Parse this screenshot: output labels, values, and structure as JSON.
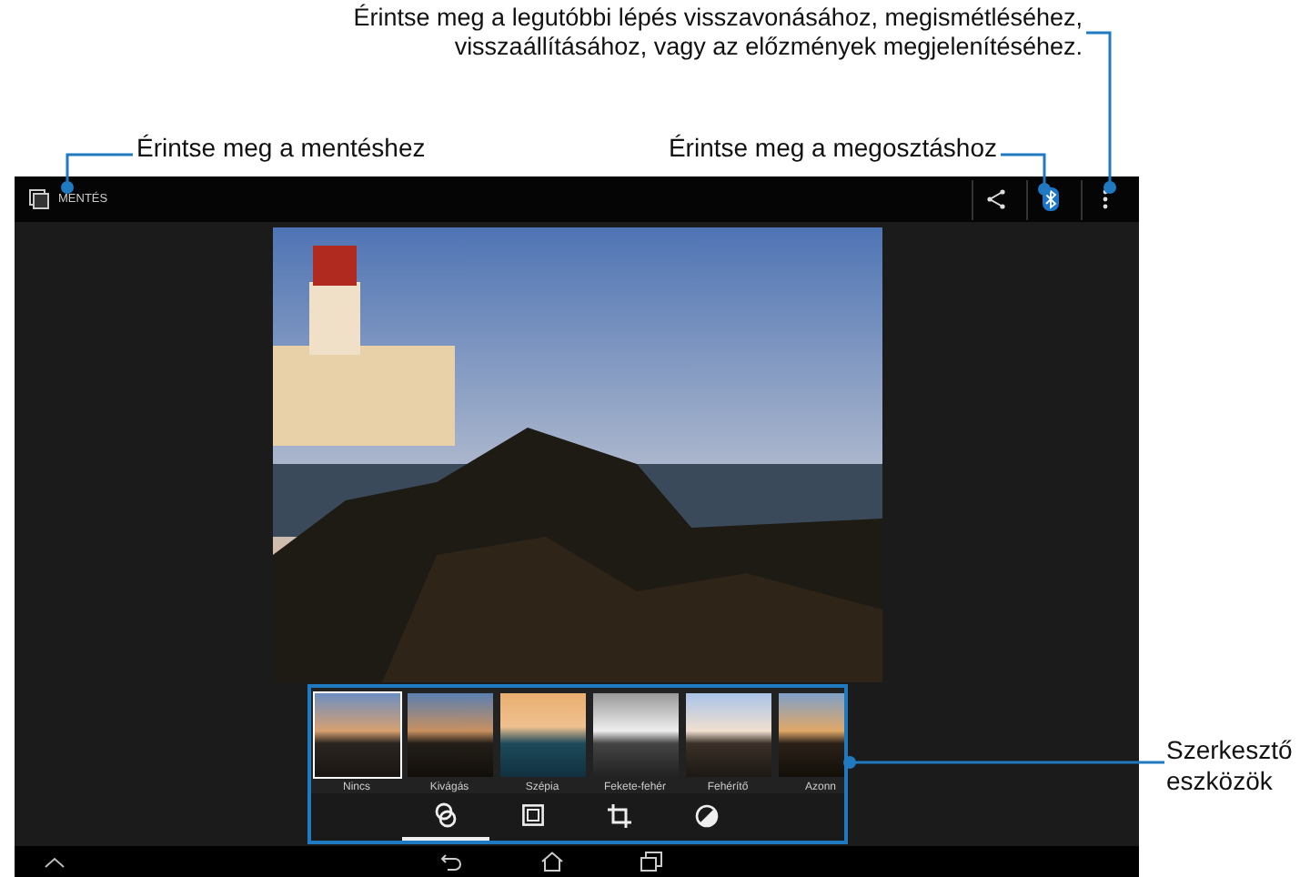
{
  "annotations": {
    "history_hint": "Érintse meg a legutóbbi lépés visszavonásához, megismétléséhez,\nvisszaállításához, vagy az előzmények megjelenítéséhez.",
    "save_hint": "Érintse meg a mentéshez",
    "share_hint": "Érintse meg a megosztáshoz",
    "tools_hint": "Szerkesztő\neszközök"
  },
  "top_bar": {
    "save_label": "MENTÉS"
  },
  "filters": [
    {
      "label": "Nincs",
      "selected": true
    },
    {
      "label": "Kivágás",
      "selected": false
    },
    {
      "label": "Szépia",
      "selected": false
    },
    {
      "label": "Fekete-fehér",
      "selected": false
    },
    {
      "label": "Fehérítő",
      "selected": false
    },
    {
      "label": "Azonn",
      "selected": false
    }
  ],
  "tools": [
    {
      "kind": "filters",
      "selected": true
    },
    {
      "kind": "border",
      "selected": false
    },
    {
      "kind": "crop",
      "selected": false
    },
    {
      "kind": "exposure",
      "selected": false
    }
  ]
}
